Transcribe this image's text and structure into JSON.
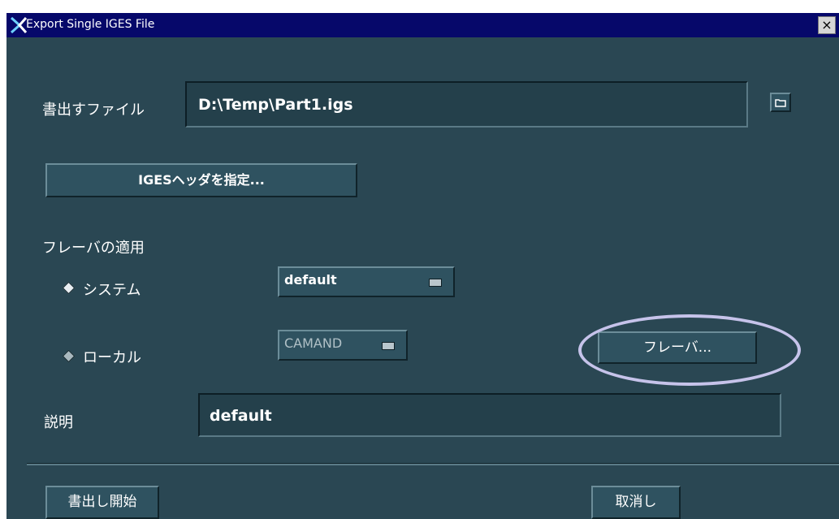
{
  "window": {
    "title": "Export Single IGES File",
    "close_label": "×"
  },
  "file": {
    "label": "書出すファイル",
    "value": "D:\\Temp\\Part1.igs"
  },
  "header_button": "IGESヘッダを指定...",
  "flavor": {
    "section_label": "フレーバの適用",
    "system_label": "システム",
    "system_value": "default",
    "local_label": "ローカル",
    "local_value": "CAMAND",
    "flavor_button": "フレーバ..."
  },
  "description": {
    "label": "説明",
    "value": "default"
  },
  "actions": {
    "start": "書出し開始",
    "cancel": "取消し"
  },
  "colors": {
    "background": "#2a4753",
    "titlebar": "#06086a",
    "highlight_ellipse": "#c6c3ea"
  }
}
